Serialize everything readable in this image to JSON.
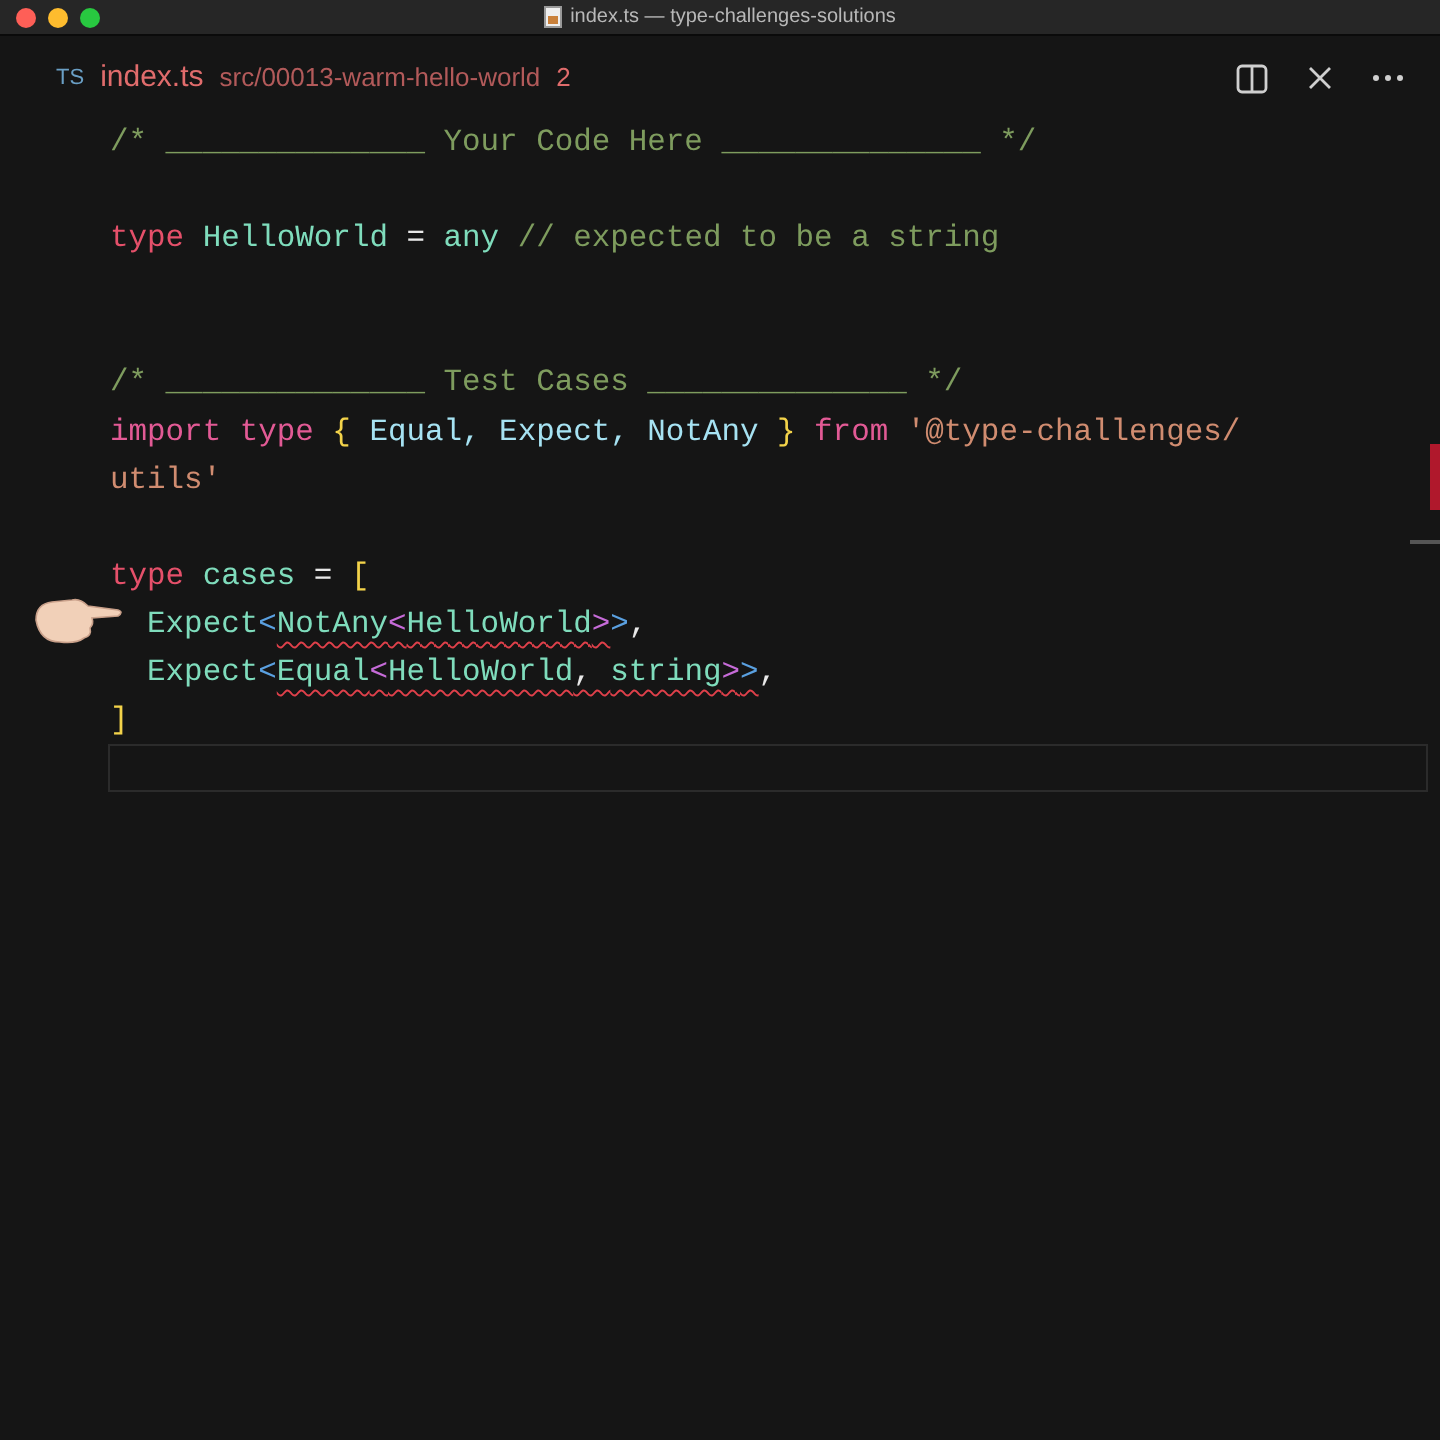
{
  "window": {
    "title": "index.ts — type-challenges-solutions"
  },
  "tab": {
    "badge": "TS",
    "filename": "index.ts",
    "path": "src/00013-warm-hello-world",
    "problems": "2"
  },
  "editor": {
    "lines": [
      {
        "kind": "code",
        "current": false,
        "tokens": [
          {
            "text": "/* ______________ Your Code Here ______________ */",
            "kind": "comment",
            "error": false
          }
        ]
      },
      {
        "kind": "blank",
        "current": false
      },
      {
        "kind": "code",
        "current": false,
        "tokens": [
          {
            "text": "type",
            "kind": "keyword",
            "error": false
          },
          {
            "text": " HelloWorld",
            "kind": "type",
            "error": false
          },
          {
            "text": " = ",
            "kind": "plain",
            "error": false
          },
          {
            "text": "any",
            "kind": "type",
            "error": false
          },
          {
            "text": " // expected to be a string",
            "kind": "comment",
            "error": false
          }
        ]
      },
      {
        "kind": "blank",
        "current": false
      },
      {
        "kind": "blank",
        "current": false
      },
      {
        "kind": "code",
        "current": false,
        "tokens": [
          {
            "text": "/* ______________ Test Cases ______________ */",
            "kind": "comment",
            "error": false
          }
        ]
      },
      {
        "kind": "code",
        "current": false,
        "tokens": [
          {
            "text": "import type",
            "kind": "control",
            "error": false
          },
          {
            "text": " {",
            "kind": "brace",
            "error": false
          },
          {
            "text": " Equal, Expect, NotAny ",
            "kind": "name",
            "error": false
          },
          {
            "text": "}",
            "kind": "brace",
            "error": false
          },
          {
            "text": " from",
            "kind": "control",
            "error": false
          },
          {
            "text": " '@type-challenges/",
            "kind": "string",
            "error": false
          }
        ]
      },
      {
        "kind": "code",
        "current": false,
        "tokens": [
          {
            "text": "utils'",
            "kind": "string",
            "error": false
          }
        ]
      },
      {
        "kind": "blank",
        "current": false
      },
      {
        "kind": "code",
        "current": false,
        "tokens": [
          {
            "text": "type",
            "kind": "keyword",
            "error": false
          },
          {
            "text": " cases",
            "kind": "type",
            "error": false
          },
          {
            "text": " = ",
            "kind": "plain",
            "error": false
          },
          {
            "text": "[",
            "kind": "brace",
            "error": false
          }
        ]
      },
      {
        "kind": "code",
        "current": false,
        "tokens": [
          {
            "text": "  Expect",
            "kind": "type",
            "error": false
          },
          {
            "text": "<",
            "kind": "angle1",
            "error": false
          },
          {
            "text": "NotAny",
            "kind": "type",
            "error": true
          },
          {
            "text": "<",
            "kind": "angle2",
            "error": true
          },
          {
            "text": "HelloWorld",
            "kind": "type",
            "error": true
          },
          {
            "text": ">",
            "kind": "angle2",
            "error": true
          },
          {
            "text": ">",
            "kind": "angle1",
            "error": false
          },
          {
            "text": ",",
            "kind": "plain",
            "error": false
          }
        ]
      },
      {
        "kind": "code",
        "current": false,
        "tokens": [
          {
            "text": "  Expect",
            "kind": "type",
            "error": false
          },
          {
            "text": "<",
            "kind": "angle1",
            "error": false
          },
          {
            "text": "Equal",
            "kind": "type",
            "error": true
          },
          {
            "text": "<",
            "kind": "angle2",
            "error": true
          },
          {
            "text": "HelloWorld",
            "kind": "type",
            "error": true
          },
          {
            "text": ", ",
            "kind": "plain",
            "error": true
          },
          {
            "text": "string",
            "kind": "type",
            "error": true
          },
          {
            "text": ">",
            "kind": "angle2",
            "error": true
          },
          {
            "text": ">",
            "kind": "angle1",
            "error": true
          },
          {
            "text": ",",
            "kind": "plain",
            "error": false
          }
        ]
      },
      {
        "kind": "code",
        "current": false,
        "tokens": [
          {
            "text": "]",
            "kind": "brace",
            "error": false
          }
        ]
      },
      {
        "kind": "blank",
        "current": true
      }
    ]
  }
}
